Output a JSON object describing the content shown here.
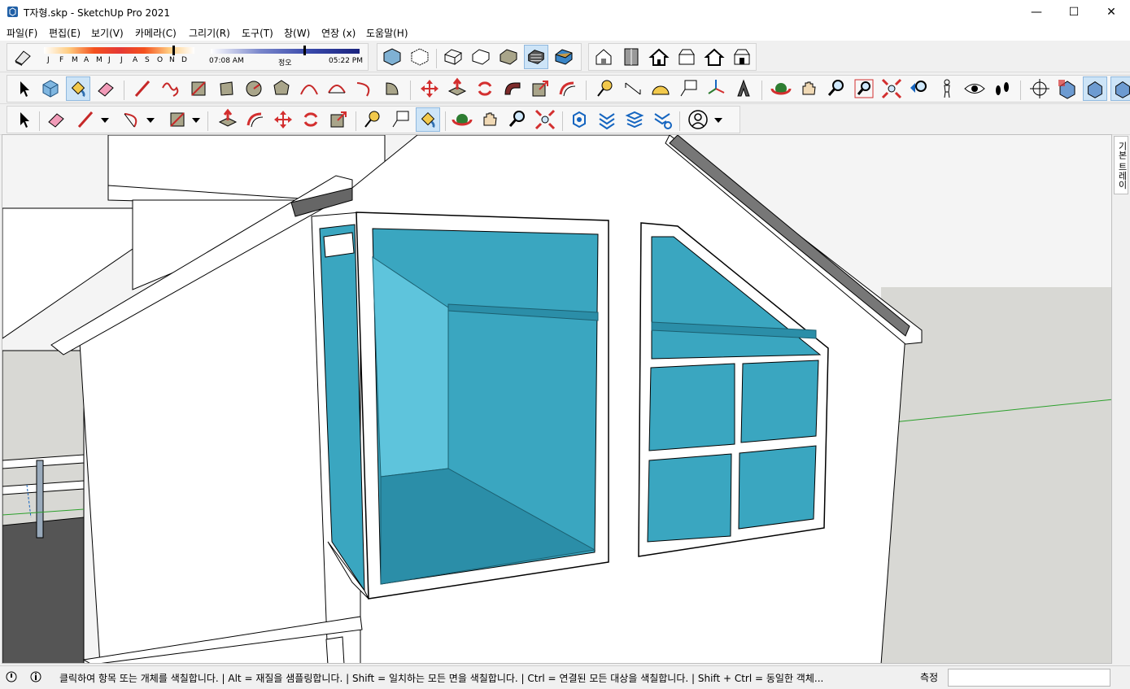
{
  "window": {
    "title": "T자형.skp - SketchUp Pro 2021",
    "minimize_glyph": "—",
    "maximize_glyph": "☐",
    "close_glyph": "✕"
  },
  "menu": [
    {
      "label": "파일(F)"
    },
    {
      "label": "편집(E)"
    },
    {
      "label": "보기(V)"
    },
    {
      "label": "카메라(C)"
    },
    {
      "label": "그리기(R)"
    },
    {
      "label": "도구(T)"
    },
    {
      "label": "창(W)"
    },
    {
      "label": "연장 (x)"
    },
    {
      "label": "도움말(H)"
    }
  ],
  "shadows": {
    "months": [
      "J",
      "F",
      "M",
      "A",
      "M",
      "J",
      "J",
      "A",
      "S",
      "O",
      "N",
      "D"
    ],
    "time_start": "07:08 AM",
    "time_mid": "정오",
    "time_end": "05:22 PM"
  },
  "tray": {
    "label": "기본 트레이"
  },
  "status": {
    "message": "클릭하여 항목 또는 개체를 색칠합니다. | Alt = 재질을 샘플링합니다. | Shift = 일치하는 모든 면을 색칠합니다. | Ctrl = 연결된 모든 대상을 색칠합니다. | Shift + Ctrl = 동일한 객체...",
    "measure_label": "측정",
    "measure_value": ""
  },
  "colors": {
    "glass": "#3aa6c0",
    "glass_light": "#5ec4dc",
    "glass_dark": "#2b8ea8",
    "wall": "#ffffff",
    "edge": "#000000",
    "ground": "#d8d8d4",
    "sky": "#f2f2f2",
    "axis_green": "#2ca02c",
    "active_tool": "#cde4f7"
  }
}
